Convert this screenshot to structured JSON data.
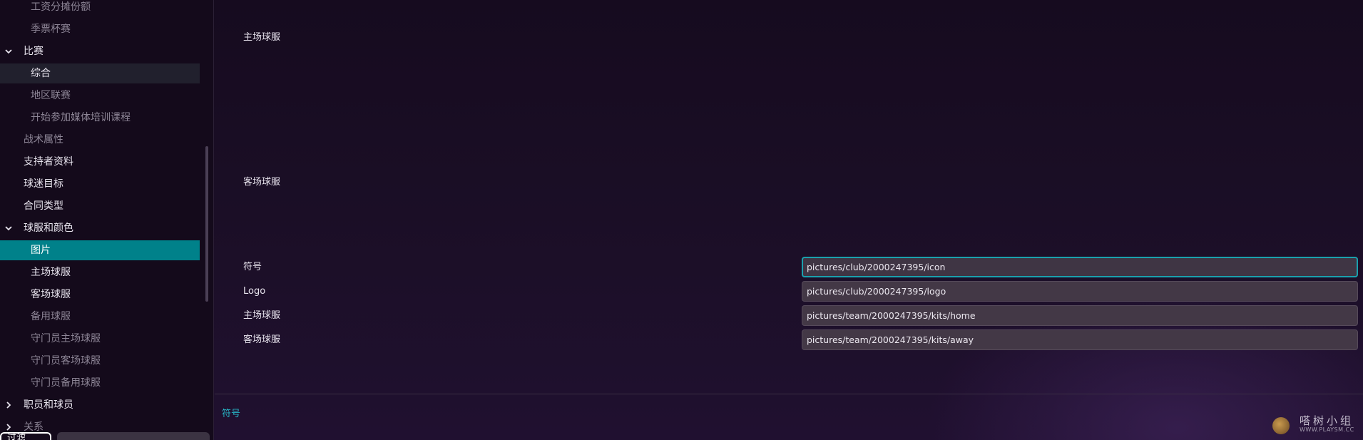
{
  "sidebar": {
    "items": [
      {
        "label": "工资分摊份额",
        "level": 2,
        "state": "dim",
        "chevron": "",
        "top": 0
      },
      {
        "label": "季票杯赛",
        "level": 2,
        "state": "dim",
        "chevron": ""
      },
      {
        "label": "比赛",
        "level": 1,
        "state": "normal",
        "chevron": "chevron-down"
      },
      {
        "label": "综合",
        "level": 2,
        "state": "selected",
        "chevron": ""
      },
      {
        "label": "地区联赛",
        "level": 2,
        "state": "dim",
        "chevron": ""
      },
      {
        "label": "开始参加媒体培训课程",
        "level": 2,
        "state": "dim",
        "chevron": ""
      },
      {
        "label": "战术属性",
        "level": 1,
        "state": "dim",
        "chevron": ""
      },
      {
        "label": "支持者资料",
        "level": 1,
        "state": "normal",
        "chevron": ""
      },
      {
        "label": "球迷目标",
        "level": 1,
        "state": "normal",
        "chevron": ""
      },
      {
        "label": "合同类型",
        "level": 1,
        "state": "normal",
        "chevron": ""
      },
      {
        "label": "球服和颜色",
        "level": 1,
        "state": "normal",
        "chevron": "chevron-down"
      },
      {
        "label": "图片",
        "level": 2,
        "state": "active",
        "chevron": ""
      },
      {
        "label": "主场球服",
        "level": 2,
        "state": "normal",
        "chevron": ""
      },
      {
        "label": "客场球服",
        "level": 2,
        "state": "normal",
        "chevron": ""
      },
      {
        "label": "备用球服",
        "level": 2,
        "state": "dim",
        "chevron": ""
      },
      {
        "label": "守门员主场球服",
        "level": 2,
        "state": "dim",
        "chevron": ""
      },
      {
        "label": "守门员客场球服",
        "level": 2,
        "state": "dim",
        "chevron": ""
      },
      {
        "label": "守门员备用球服",
        "level": 2,
        "state": "dim",
        "chevron": ""
      },
      {
        "label": "职员和球员",
        "level": 1,
        "state": "normal",
        "chevron": "chevron-right"
      },
      {
        "label": "关系",
        "level": 1,
        "state": "dim",
        "chevron": "chevron-right"
      }
    ],
    "filter_label": "过滤"
  },
  "main": {
    "preview_home_label": "主场球服",
    "preview_away_label": "客场球服",
    "fields": [
      {
        "label": "符号",
        "value": "pictures/club/2000247395/icon",
        "focused": true
      },
      {
        "label": "Logo",
        "value": "pictures/club/2000247395/logo",
        "focused": false
      },
      {
        "label": "主场球服",
        "value": "pictures/team/2000247395/kits/home",
        "focused": false
      },
      {
        "label": "客场球服",
        "value": "pictures/team/2000247395/kits/away",
        "focused": false
      }
    ],
    "footer_info": "符号"
  },
  "watermark": {
    "title": "嗒树小组",
    "url": "WWW.PLAYSM.CC"
  },
  "colors": {
    "accent_teal": "#00818a",
    "focus_border": "#1aa0ad",
    "info_text": "#27b6c6"
  }
}
